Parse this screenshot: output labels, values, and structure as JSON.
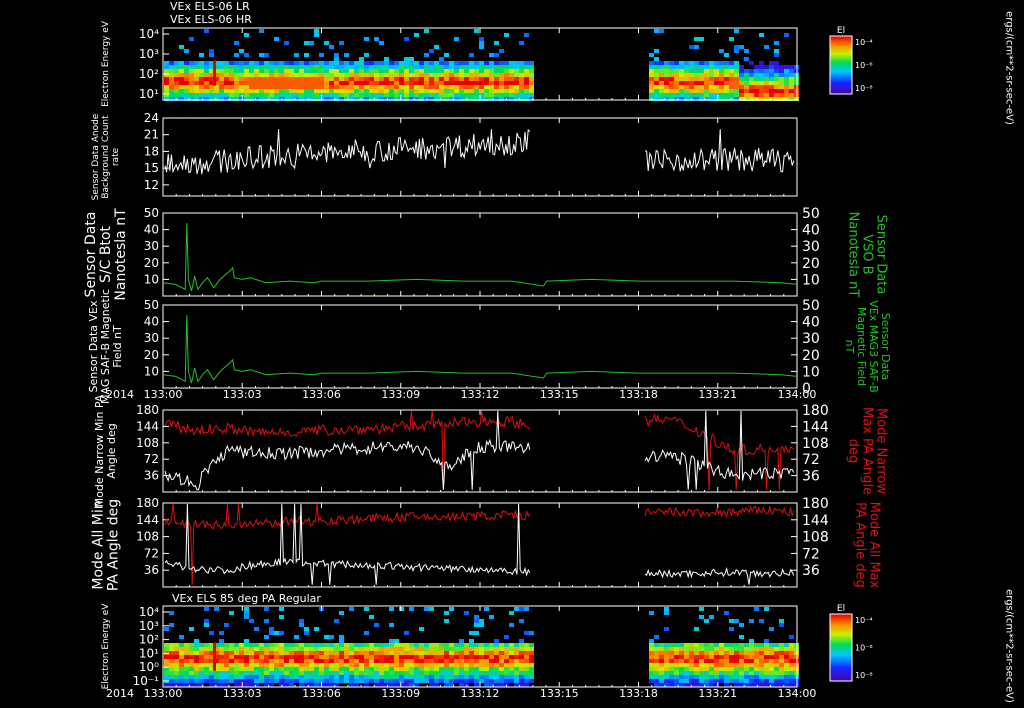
{
  "header": {
    "line1": "VEx ELS-06 LR",
    "line2": "VEx ELS-06 HR"
  },
  "colors": {
    "background": "#000000",
    "axis": "#ffffff",
    "green": "#22c422",
    "red": "#e01010",
    "white": "#ffffff"
  },
  "x_axis": {
    "year": "2014",
    "ticks": [
      "133:00",
      "133:03",
      "133:06",
      "133:09",
      "133:12",
      "133:15",
      "133:18",
      "133:21",
      "134:00"
    ]
  },
  "chart_data": [
    {
      "type": "heatmap",
      "title": "",
      "ylabel": "Electron Energy eV",
      "y_ticks": [
        "10⁴",
        "10³",
        "10²",
        "10¹"
      ],
      "colorbar": {
        "title": "El",
        "ticks": [
          "10⁻⁴",
          "10⁻⁶",
          "10⁻⁸"
        ],
        "unit": "ergs/(cm**2-sr-sec-eV)"
      },
      "data_gap": [
        "133:14",
        "133:18"
      ]
    },
    {
      "type": "line",
      "ylabel": "Sensor Data Anode Background Count rate",
      "y_ticks": [
        "24",
        "21",
        "18",
        "15",
        "12"
      ],
      "ylim": [
        10,
        24
      ],
      "series": [
        {
          "name": "",
          "color": "white",
          "base": [
            16,
            16,
            17,
            17.5,
            18,
            18.5,
            19,
            19.5,
            20,
            19.5,
            16.5,
            16.5,
            16.5,
            16.5
          ],
          "noise": 2.2
        }
      ]
    },
    {
      "type": "line",
      "ylabel": "Sensor Data S/C Btot Nanotesla nT",
      "right_label": "Sensor Data VSO B Nanotesla nT",
      "y_ticks": [
        "50",
        "40",
        "30",
        "20",
        "10"
      ],
      "right_ticks": [
        "50",
        "40",
        "30",
        "20",
        "10"
      ],
      "ylim": [
        0,
        50
      ],
      "series": [
        {
          "name": "",
          "color": "green"
        }
      ],
      "points": [
        [
          0,
          8
        ],
        [
          0.08,
          7
        ],
        [
          0.12,
          5
        ],
        [
          0.14,
          4
        ],
        [
          0.15,
          44
        ],
        [
          0.16,
          10
        ],
        [
          0.18,
          3
        ],
        [
          0.2,
          12
        ],
        [
          0.22,
          4
        ],
        [
          0.25,
          8
        ],
        [
          0.28,
          11
        ],
        [
          0.32,
          5
        ],
        [
          0.36,
          10
        ],
        [
          0.42,
          15
        ],
        [
          0.44,
          17
        ],
        [
          0.45,
          11
        ],
        [
          0.5,
          10
        ],
        [
          0.55,
          11
        ],
        [
          0.65,
          8
        ],
        [
          0.8,
          9
        ],
        [
          0.95,
          8
        ],
        [
          1.0,
          9
        ],
        [
          1.3,
          9
        ],
        [
          1.6,
          10
        ],
        [
          1.9,
          9
        ],
        [
          2.2,
          9
        ],
        [
          2.4,
          6
        ],
        [
          2.42,
          9
        ],
        [
          2.7,
          10
        ],
        [
          3.0,
          9
        ],
        [
          3.3,
          9
        ],
        [
          3.6,
          9
        ],
        [
          3.9,
          8
        ],
        [
          4.0,
          7
        ]
      ]
    },
    {
      "type": "line",
      "ylabel": "Sensor Data VEx MAG SAF-B Magnetic Field nT",
      "right_label": "Sensor Data VEx MAG3 SAF-B Magnetic Field nT",
      "y_ticks": [
        "50",
        "40",
        "30",
        "20",
        "10"
      ],
      "right_ticks": [
        "50",
        "40",
        "30",
        "20",
        "10",
        "0"
      ],
      "ylim": [
        0,
        50
      ],
      "series": [
        {
          "name": "",
          "color": "green"
        }
      ],
      "points": [
        [
          0,
          8
        ],
        [
          0.08,
          7
        ],
        [
          0.12,
          5
        ],
        [
          0.14,
          4
        ],
        [
          0.15,
          44
        ],
        [
          0.16,
          10
        ],
        [
          0.18,
          3
        ],
        [
          0.2,
          12
        ],
        [
          0.22,
          4
        ],
        [
          0.25,
          8
        ],
        [
          0.28,
          11
        ],
        [
          0.32,
          5
        ],
        [
          0.36,
          10
        ],
        [
          0.42,
          15
        ],
        [
          0.44,
          17
        ],
        [
          0.45,
          11
        ],
        [
          0.5,
          10
        ],
        [
          0.55,
          11
        ],
        [
          0.65,
          8
        ],
        [
          0.8,
          9
        ],
        [
          0.95,
          8
        ],
        [
          1.0,
          9
        ],
        [
          1.3,
          9
        ],
        [
          1.6,
          10
        ],
        [
          1.9,
          9
        ],
        [
          2.2,
          9
        ],
        [
          2.4,
          6
        ],
        [
          2.42,
          9
        ],
        [
          2.7,
          10
        ],
        [
          3.0,
          9
        ],
        [
          3.3,
          9
        ],
        [
          3.6,
          9
        ],
        [
          3.9,
          8
        ],
        [
          4.0,
          7
        ]
      ]
    },
    {
      "type": "line",
      "ylabel": "Mode Narrow Min PA Angle deg",
      "right_label": "Mode Narrow Max PA Angle deg",
      "y_ticks": [
        "180",
        "144",
        "108",
        "72",
        "36"
      ],
      "right_ticks": [
        "180",
        "144",
        "108",
        "72",
        "36"
      ],
      "ylim": [
        0,
        180
      ],
      "series": [
        {
          "name": "",
          "color": "red",
          "base": [
            150,
            135,
            140,
            130,
            132,
            135,
            138,
            140,
            145,
            150,
            155,
            155,
            140,
            150,
            150,
            155,
            160,
            130,
            90,
            95,
            100
          ],
          "noise": 12
        },
        {
          "name": "",
          "color": "white",
          "base": [
            40,
            20,
            90,
            85,
            85,
            90,
            95,
            100,
            100,
            55,
            100,
            100,
            90,
            80,
            70,
            75,
            80,
            60,
            35,
            40,
            45
          ],
          "noise": 14
        }
      ]
    },
    {
      "type": "line",
      "ylabel": "Mode All Min PA Angle deg",
      "right_label": "Mode All Max PA Angle deg",
      "y_ticks": [
        "180",
        "144",
        "108",
        "72",
        "36"
      ],
      "right_ticks": [
        "180",
        "144",
        "108",
        "72",
        "36"
      ],
      "ylim": [
        0,
        180
      ],
      "series": [
        {
          "name": "",
          "color": "red",
          "base": [
            140,
            135,
            130,
            135,
            140,
            142,
            145,
            148,
            150,
            150,
            152,
            155,
            150,
            152,
            155,
            158,
            160,
            158,
            160,
            165,
            160
          ],
          "noise": 10
        },
        {
          "name": "",
          "color": "white",
          "base": [
            50,
            40,
            35,
            50,
            55,
            50,
            48,
            45,
            42,
            40,
            38,
            35,
            30,
            35,
            38,
            30,
            28,
            30,
            32,
            30,
            30
          ],
          "noise": 8
        }
      ]
    },
    {
      "type": "heatmap",
      "title": "VEx ELS 85 deg PA Regular",
      "ylabel": "Electron Energy eV",
      "y_ticks": [
        "10⁴",
        "10³",
        "10²",
        "10¹",
        "10⁰",
        "10⁻¹"
      ],
      "colorbar": {
        "title": "El",
        "ticks": [
          "10⁻⁴",
          "10⁻⁶",
          "10⁻⁸"
        ],
        "unit": "ergs/(cm**2-sr-sec-eV)"
      },
      "data_gap": [
        "133:14",
        "133:18"
      ]
    }
  ]
}
